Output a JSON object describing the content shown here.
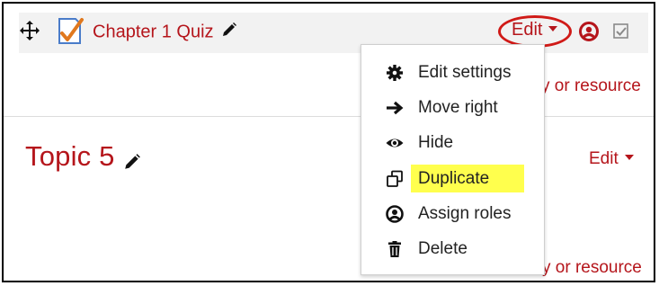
{
  "activity": {
    "name": "Chapter 1 Quiz",
    "edit_label": "Edit"
  },
  "add_link": "y or resource",
  "menu": {
    "items": [
      {
        "label": "Edit settings",
        "icon": "gear-icon"
      },
      {
        "label": "Move right",
        "icon": "arrow-right-icon"
      },
      {
        "label": "Hide",
        "icon": "eye-icon"
      },
      {
        "label": "Duplicate",
        "icon": "duplicate-icon",
        "highlighted": true
      },
      {
        "label": "Assign roles",
        "icon": "user-circle-icon"
      },
      {
        "label": "Delete",
        "icon": "trash-icon"
      }
    ]
  },
  "section": {
    "title": "Topic 5",
    "edit_label": "Edit"
  },
  "colors": {
    "link_red": "#b5151b",
    "annotation_red": "#d01a17",
    "highlight_yellow": "#ffff4d",
    "row_background": "#f2f2f2"
  }
}
